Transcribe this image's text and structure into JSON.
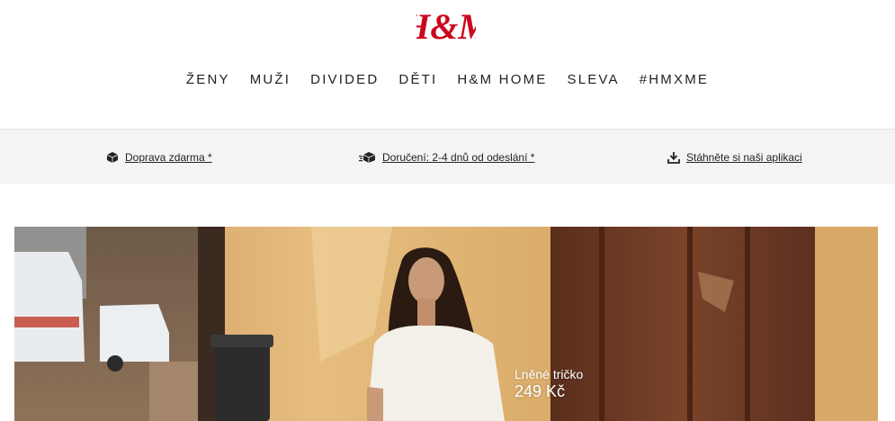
{
  "brand": {
    "logo_text": "H&M",
    "logo_color": "#cc071e"
  },
  "nav": {
    "items": [
      {
        "label": "ŽENY"
      },
      {
        "label": "MUŽI"
      },
      {
        "label": "DIVIDED"
      },
      {
        "label": "DĚTI"
      },
      {
        "label": "H&M HOME"
      },
      {
        "label": "SLEVA"
      },
      {
        "label": "#HMXME"
      }
    ]
  },
  "service_bar": {
    "items": [
      {
        "icon": "package-icon",
        "label": "Doprava zdarma *"
      },
      {
        "icon": "delivery-truck-icon",
        "label": "Doručení: 2-4 dnů od odeslání *"
      },
      {
        "icon": "download-icon",
        "label": "Stáhněte si naši aplikaci"
      }
    ]
  },
  "hero": {
    "product_name": "Lněné tričko",
    "product_price": "249 Kč"
  },
  "colors": {
    "text": "#222222",
    "service_bar_bg": "#f4f4f4",
    "hero_wall": "#d9a968",
    "hero_door": "#6b3a24"
  }
}
